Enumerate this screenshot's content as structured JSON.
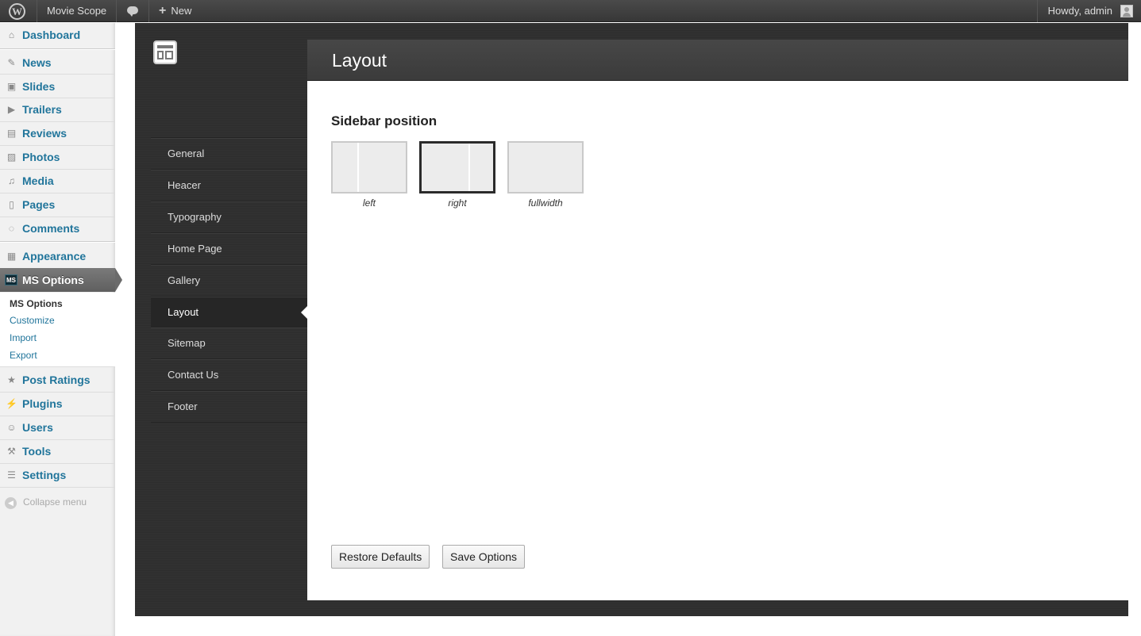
{
  "adminbar": {
    "site_name": "Movie Scope",
    "new_label": "New",
    "howdy": "Howdy, admin"
  },
  "menu": {
    "items": [
      {
        "label": "Dashboard",
        "icon": "dashboard-icon"
      },
      {
        "label": "News",
        "icon": "pin-icon"
      },
      {
        "label": "Slides",
        "icon": "slides-icon"
      },
      {
        "label": "Trailers",
        "icon": "video-icon"
      },
      {
        "label": "Reviews",
        "icon": "reviews-icon"
      },
      {
        "label": "Photos",
        "icon": "photos-icon"
      },
      {
        "label": "Media",
        "icon": "media-icon"
      },
      {
        "label": "Pages",
        "icon": "pages-icon"
      },
      {
        "label": "Comments",
        "icon": "comments-icon"
      },
      {
        "label": "Appearance",
        "icon": "appearance-icon"
      },
      {
        "label": "MS Options",
        "icon": "ms-options-icon"
      },
      {
        "label": "Post Ratings",
        "icon": "ratings-icon"
      },
      {
        "label": "Plugins",
        "icon": "plugins-icon"
      },
      {
        "label": "Users",
        "icon": "users-icon"
      },
      {
        "label": "Tools",
        "icon": "tools-icon"
      },
      {
        "label": "Settings",
        "icon": "settings-icon"
      }
    ],
    "submenu": [
      "MS Options",
      "Customize",
      "Import",
      "Export"
    ],
    "collapse_label": "Collapse menu"
  },
  "options_nav": {
    "items": [
      "General",
      "Heacer",
      "Typography",
      "Home Page",
      "Gallery",
      "Layout",
      "Sitemap",
      "Contact Us",
      "Footer"
    ],
    "active": "Layout"
  },
  "content": {
    "title": "Layout",
    "section_title": "Sidebar position",
    "sidebar_options": [
      {
        "label": "left"
      },
      {
        "label": "right"
      },
      {
        "label": "fullwidth"
      }
    ],
    "selected_option": "right",
    "restore_label": "Restore Defaults",
    "save_label": "Save Options"
  },
  "colors": {
    "link": "#21759b",
    "panel_dark": "#2f2f2f",
    "active_menu": "#6b6b6b"
  }
}
